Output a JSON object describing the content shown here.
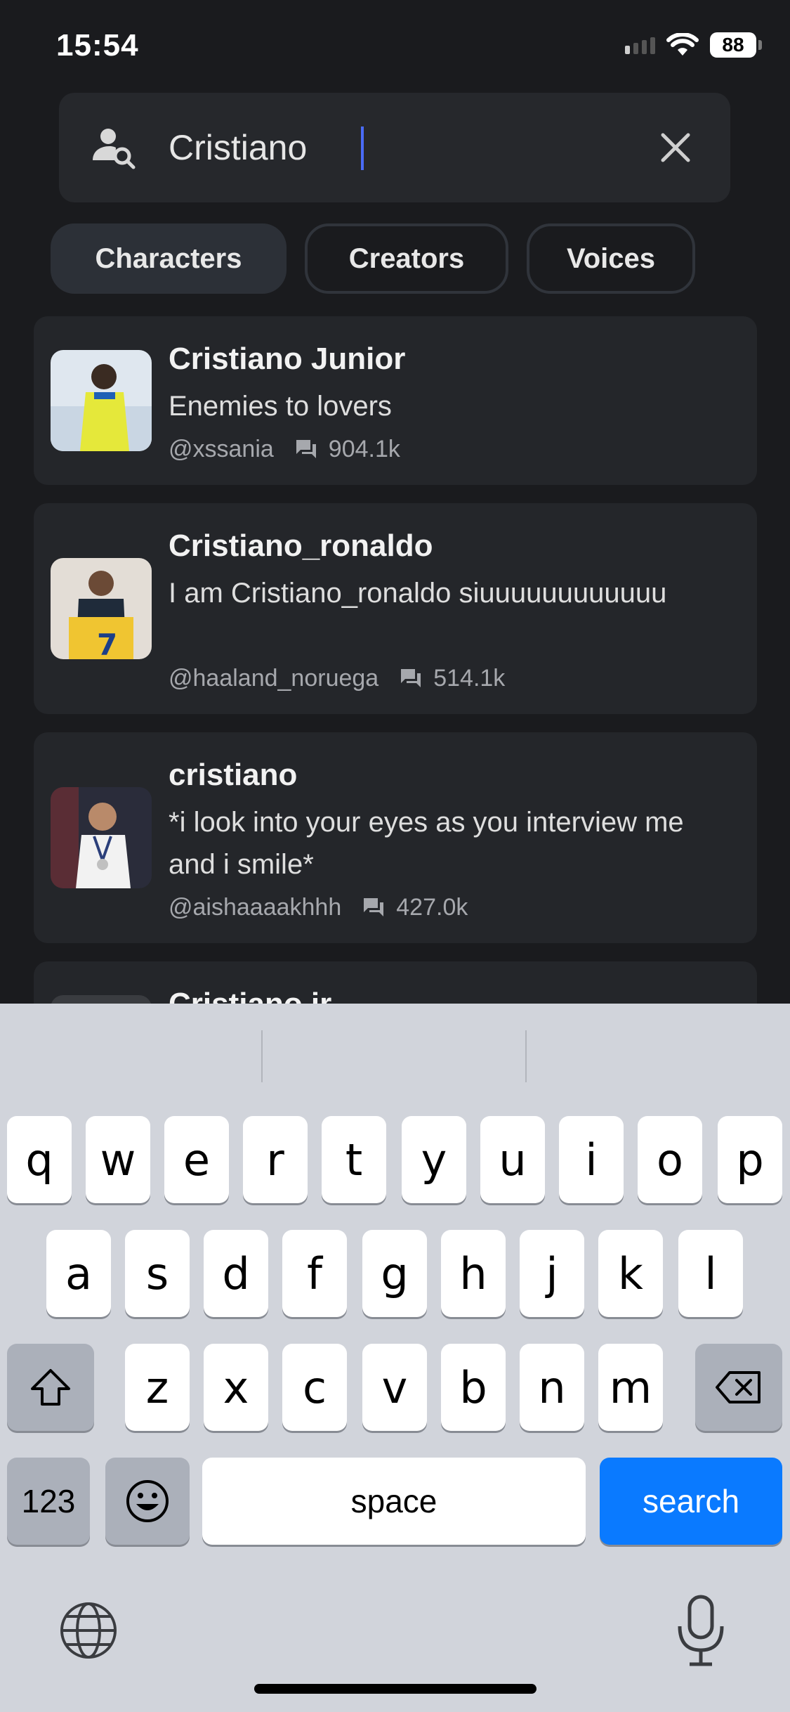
{
  "status_bar": {
    "time": "15:54",
    "battery": "88"
  },
  "search": {
    "value": "Cristiano",
    "icon": "person-search-icon",
    "clear_icon": "close-icon"
  },
  "tabs": [
    {
      "label": "Characters",
      "active": true
    },
    {
      "label": "Creators",
      "active": false
    },
    {
      "label": "Voices",
      "active": false
    }
  ],
  "results": [
    {
      "name": "Cristiano Junior",
      "description": "Enemies to lovers",
      "handle": "@xssania",
      "chats": "904.1k"
    },
    {
      "name": "Cristiano_ronaldo",
      "description": "I am Cristiano_ronaldo siuuuuuuuuuuuu",
      "handle": "@haaland_noruega",
      "chats": "514.1k"
    },
    {
      "name": "cristiano",
      "description": "*i look into your eyes as you interview me and i smile*",
      "handle": "@aishaaaakhhh",
      "chats": "427.0k"
    },
    {
      "name": "Cristiano jr"
    }
  ],
  "keyboard": {
    "row1": [
      "q",
      "w",
      "e",
      "r",
      "t",
      "y",
      "u",
      "i",
      "o",
      "p"
    ],
    "row2": [
      "a",
      "s",
      "d",
      "f",
      "g",
      "h",
      "j",
      "k",
      "l"
    ],
    "row3": [
      "z",
      "x",
      "c",
      "v",
      "b",
      "n",
      "m"
    ],
    "numbers_label": "123",
    "space_label": "space",
    "action_label": "search"
  },
  "colors": {
    "background": "#1a1b1e",
    "card": "#24262a",
    "accent": "#0a7aff",
    "caret": "#4a6cf7"
  }
}
